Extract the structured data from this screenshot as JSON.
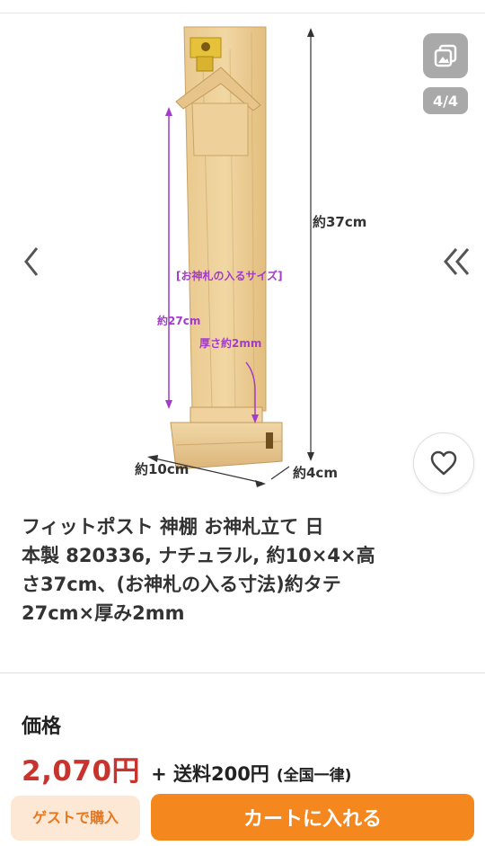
{
  "gallery": {
    "counter": "4/4",
    "image_labels": {
      "slip_size": "[お神札の入るサイズ]",
      "height_total": "約37cm",
      "slip_height": "約27cm",
      "thickness": "厚さ約2mm",
      "width": "約10cm",
      "depth": "約4cm"
    }
  },
  "product": {
    "title_lines": [
      "フィットポスト 神棚 お神札立て 日",
      "本製 820336, ナチュラル, 約10×4×高",
      "さ37cm、(お神札の入る寸法)約タテ",
      "27cm×厚み2mm"
    ]
  },
  "price": {
    "label": "価格",
    "value": "2,070円",
    "shipping": "+ 送料200円",
    "shipping_note": "(全国一律)"
  },
  "actions": {
    "secondary_label": "ゲストで購入",
    "primary_label": "カートに入れる"
  },
  "colors": {
    "price": "#c8332d",
    "accent": "#f4881f",
    "dimension_purple": "#a33cc8"
  }
}
